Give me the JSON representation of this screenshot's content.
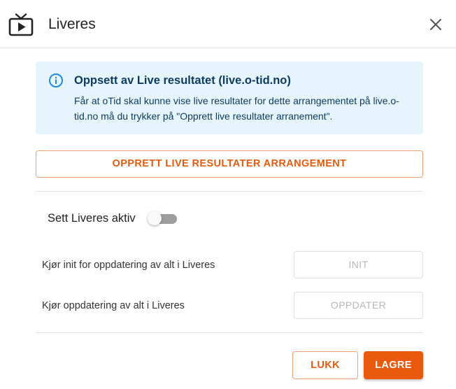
{
  "dialog": {
    "title": "Liveres",
    "title_icon": "live-tv-icon",
    "close_icon": "close-icon"
  },
  "info": {
    "icon": "info-icon",
    "title": "Oppsett av Live resultatet (live.o-tid.no)",
    "text": "Får at oTid skal kunne vise live resultater for dette arrangementet på live.o-tid.no må du trykker på \"Opprett live resultater arranement\"."
  },
  "create_button": {
    "label": "OPPRETT LIVE RESULTATER ARRANGEMENT"
  },
  "toggle": {
    "label": "Sett Liveres aktiv",
    "checked": false
  },
  "actions": [
    {
      "label": "Kjør init for oppdatering av alt i Liveres",
      "button": "INIT",
      "disabled": true
    },
    {
      "label": "Kjør oppdatering av alt i Liveres",
      "button": "OPPDATER",
      "disabled": true
    }
  ],
  "footer": {
    "close_label": "LUKK",
    "save_label": "LAGRE"
  },
  "colors": {
    "accent": "#e95a0c",
    "info_background": "#e6f5fc",
    "info_text": "#0d3c61",
    "info_icon": "#1e88e5"
  }
}
